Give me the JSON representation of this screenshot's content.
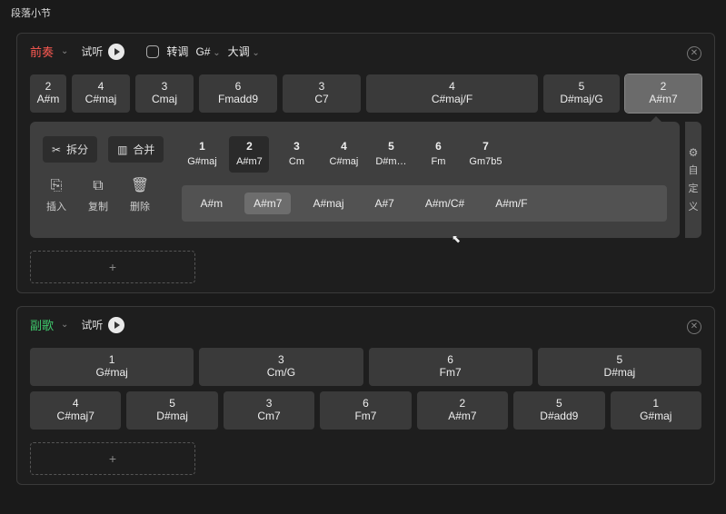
{
  "page_title": "段落小节",
  "common": {
    "listen_label": "试听",
    "transpose_label": "转调",
    "close_glyph": "✕",
    "add_glyph": "+"
  },
  "section1": {
    "name": "前奏",
    "key": "G#",
    "mode": "大调",
    "chords": [
      {
        "num": "2",
        "label": "A#m"
      },
      {
        "num": "4",
        "label": "C#maj"
      },
      {
        "num": "3",
        "label": "Cmaj"
      },
      {
        "num": "6",
        "label": "Fmadd9"
      },
      {
        "num": "3",
        "label": "C7"
      },
      {
        "num": "4",
        "label": "C#maj/F"
      },
      {
        "num": "5",
        "label": "D#maj/G"
      },
      {
        "num": "2",
        "label": "A#m7",
        "selected": true
      }
    ],
    "editor": {
      "tools": {
        "split": "拆分",
        "merge": "合并",
        "insert": "插入",
        "copy": "复制",
        "delete": "删除"
      },
      "degrees": [
        {
          "n": "1",
          "ch": "G#maj"
        },
        {
          "n": "2",
          "ch": "A#m7",
          "active": true
        },
        {
          "n": "3",
          "ch": "Cm"
        },
        {
          "n": "4",
          "ch": "C#maj"
        },
        {
          "n": "5",
          "ch": "D#m…"
        },
        {
          "n": "6",
          "ch": "Fm"
        },
        {
          "n": "7",
          "ch": "Gm7b5"
        }
      ],
      "variants": [
        {
          "v": "A#m"
        },
        {
          "v": "A#m7",
          "active": true
        },
        {
          "v": "A#maj"
        },
        {
          "v": "A#7"
        },
        {
          "v": "A#m/C#"
        },
        {
          "v": "A#m/F"
        }
      ],
      "sidebar_label": "自定义"
    }
  },
  "section2": {
    "name": "副歌",
    "rows": [
      [
        {
          "num": "1",
          "label": "G#maj"
        },
        {
          "num": "3",
          "label": "Cm/G"
        },
        {
          "num": "6",
          "label": "Fm7"
        },
        {
          "num": "5",
          "label": "D#maj"
        }
      ],
      [
        {
          "num": "4",
          "label": "C#maj7"
        },
        {
          "num": "5",
          "label": "D#maj"
        },
        {
          "num": "3",
          "label": "Cm7"
        },
        {
          "num": "6",
          "label": "Fm7"
        },
        {
          "num": "2",
          "label": "A#m7"
        },
        {
          "num": "5",
          "label": "D#add9"
        },
        {
          "num": "1",
          "label": "G#maj"
        }
      ]
    ]
  }
}
